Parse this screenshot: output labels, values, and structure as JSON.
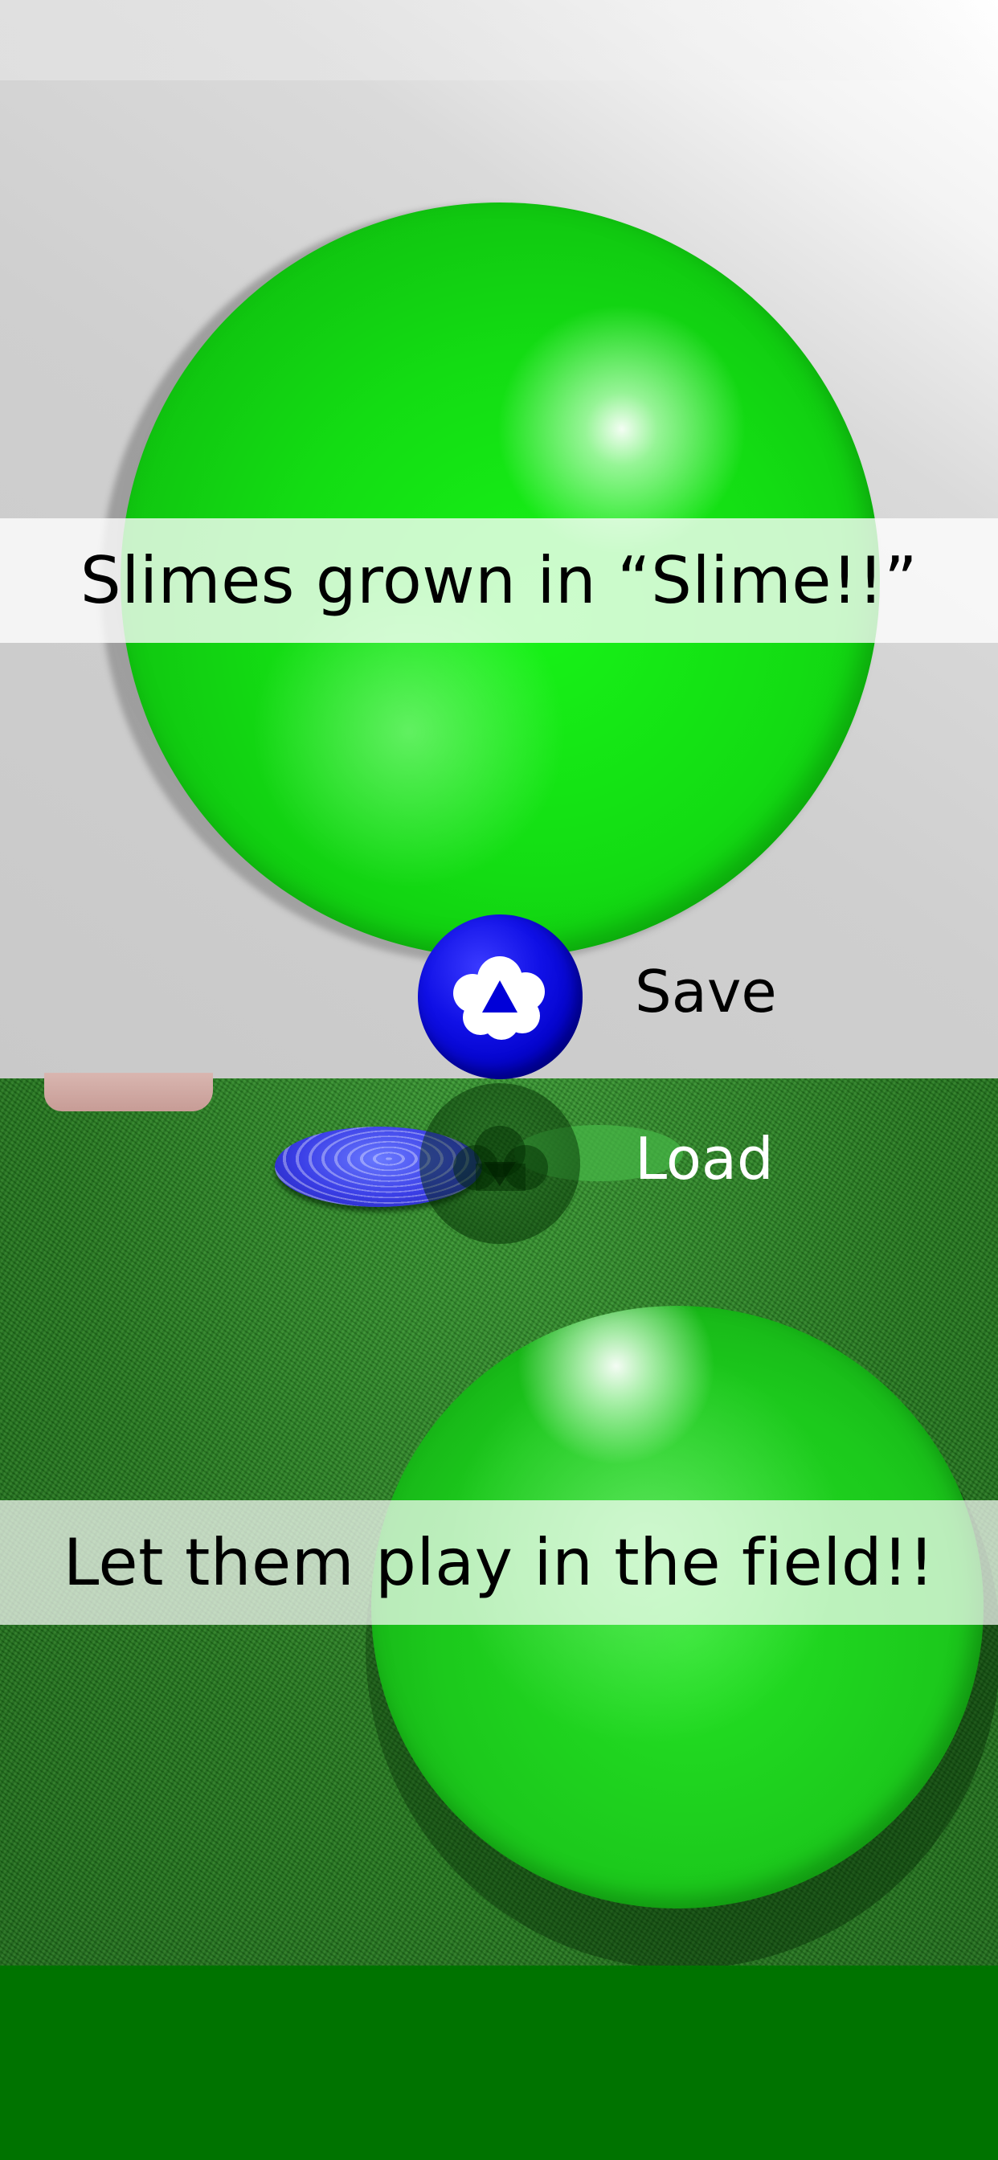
{
  "captions": {
    "top": "Slimes grown in “Slime!!”",
    "bottom": "Let them play in the field!!"
  },
  "controls": {
    "save_label": "Save",
    "load_label": "Load",
    "save_icon": "cloud-upload-icon",
    "load_icon": "cloud-download-icon"
  },
  "colors": {
    "slime_green": "#13dc13",
    "button_blue": "#1010e6",
    "grass": "#2c8a2a",
    "bottom_bar": "#007300",
    "wall": "#cfcfcf"
  }
}
